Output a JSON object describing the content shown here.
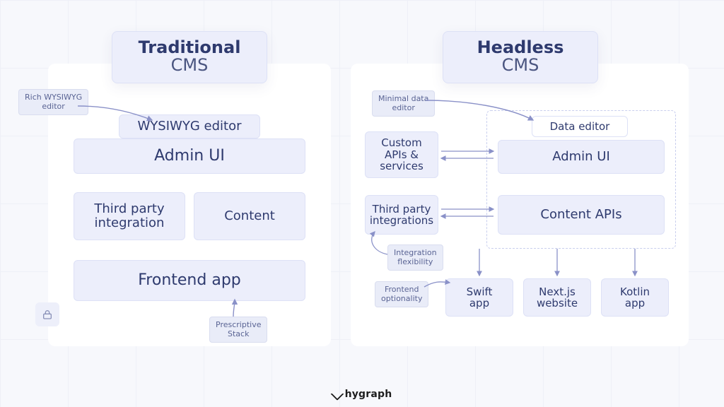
{
  "brand": "hygraph",
  "left": {
    "title_top": "Traditional",
    "title_bottom": "CMS",
    "wysiwyg": "WYSIWYG editor",
    "admin": "Admin UI",
    "third_party": "Third party\nintegration",
    "content": "Content",
    "frontend": "Frontend app"
  },
  "right": {
    "title_top": "Headless",
    "title_bottom": "CMS",
    "custom_apis": "Custom\nAPIs &\nservices",
    "third_party": "Third party\nintegrations",
    "data_editor": "Data editor",
    "admin": "Admin UI",
    "content_apis": "Content APIs",
    "swift": "Swift\napp",
    "next": "Next.js\nwebsite",
    "kotlin": "Kotlin\napp"
  },
  "tags": {
    "rich_editor": "Rich WYSIWYG\neditor",
    "prescriptive": "Prescriptive\nStack",
    "minimal_editor": "Minimal data\neditor",
    "integration_flex": "Integration\nflexibility",
    "frontend_opt": "Frontend\noptionality"
  }
}
